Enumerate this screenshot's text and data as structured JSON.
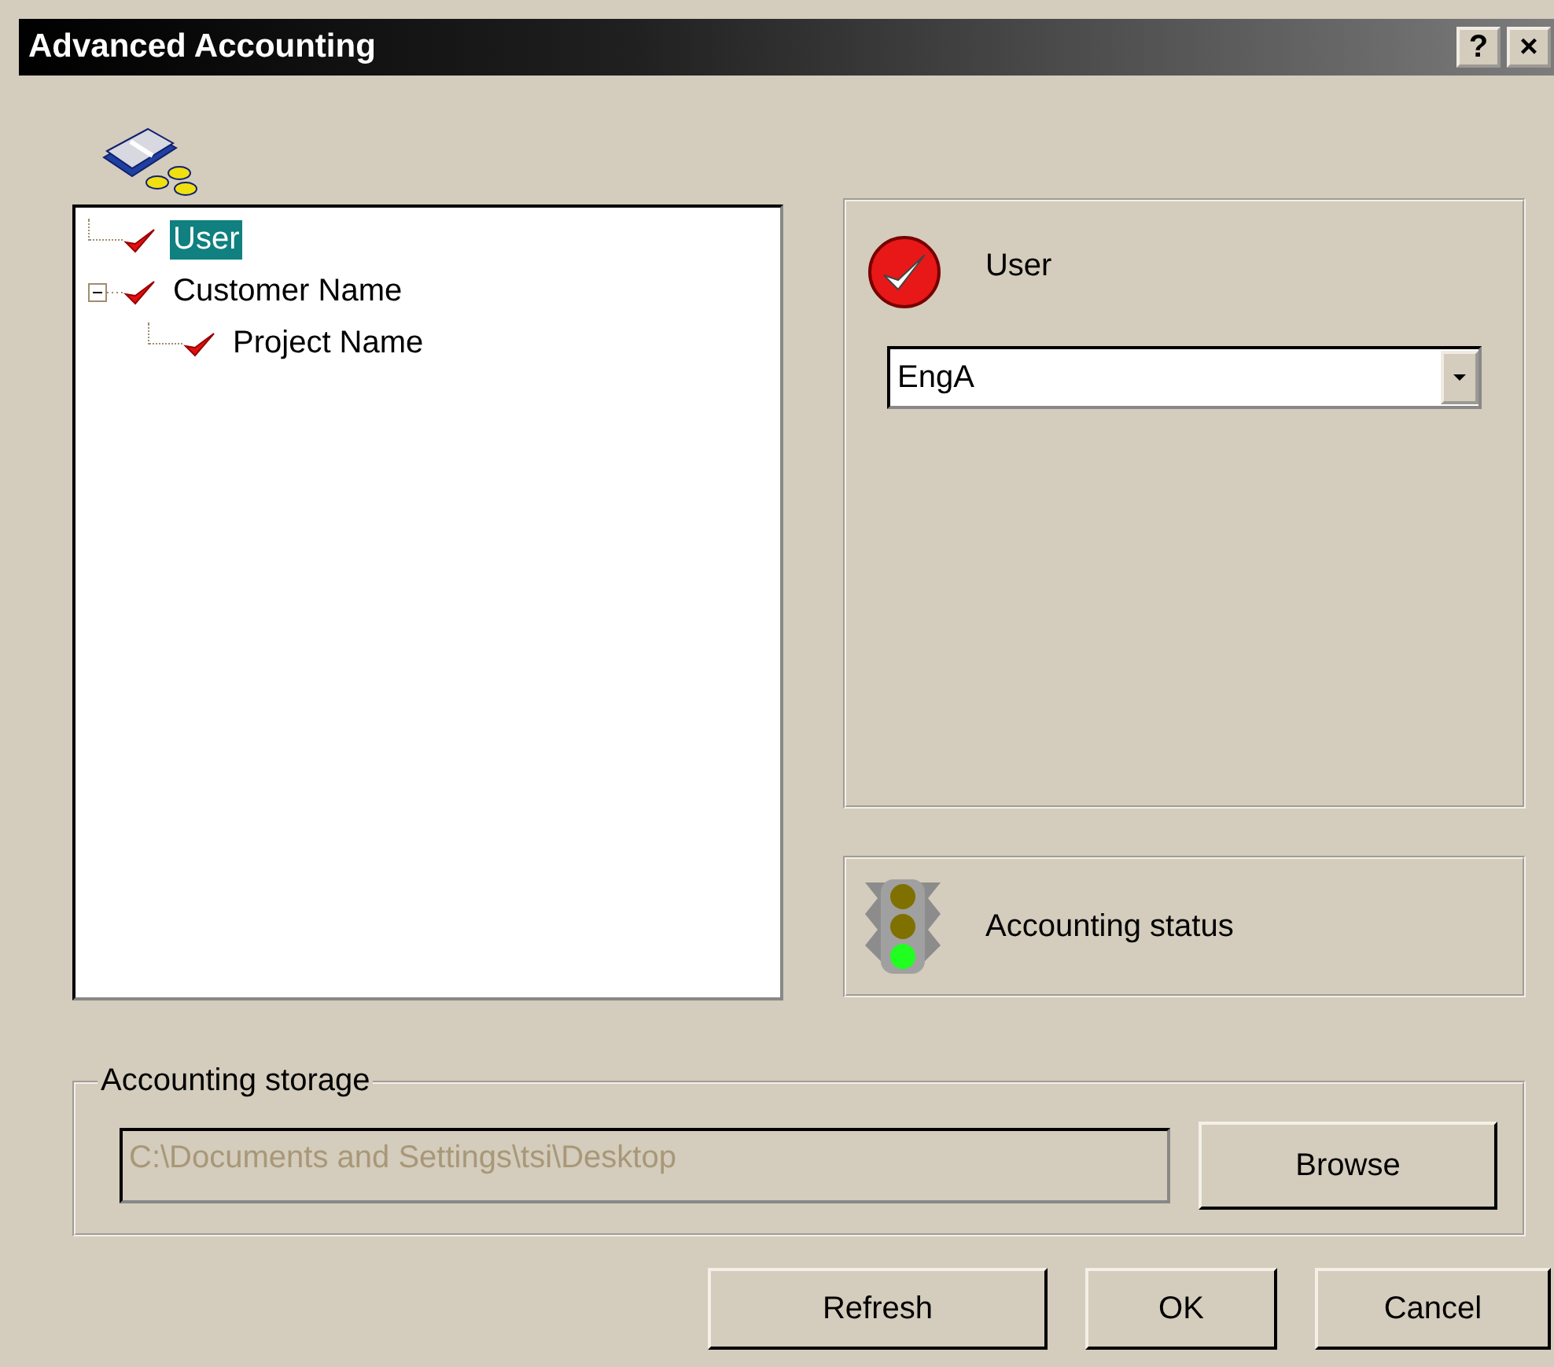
{
  "window": {
    "title": "Advanced Accounting",
    "help_button": "?",
    "close_button": "×"
  },
  "tree": {
    "items": [
      {
        "label": "User",
        "checked": true,
        "selected": true
      },
      {
        "label": "Customer Name",
        "checked": true,
        "selected": false,
        "expanded": true,
        "children": [
          {
            "label": "Project Name",
            "checked": true,
            "selected": false
          }
        ]
      }
    ]
  },
  "detail": {
    "heading": "User",
    "dropdown": {
      "value": "EngA"
    }
  },
  "status": {
    "label": "Accounting status",
    "lights": [
      {
        "on": false
      },
      {
        "on": false
      },
      {
        "on": true
      }
    ]
  },
  "storage": {
    "legend": "Accounting storage",
    "path": {
      "value": "C:\\Documents and Settings\\tsi\\Desktop",
      "disabled": true
    },
    "browse_button": "Browse"
  },
  "buttons": [
    "Refresh",
    "OK",
    "Cancel"
  ]
}
